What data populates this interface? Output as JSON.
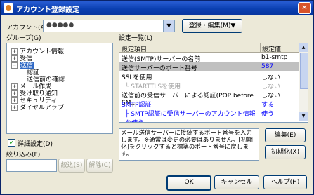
{
  "window": {
    "title": "アカウント登録設定",
    "close_label": "✕"
  },
  "account": {
    "label": "アカウント(A)",
    "value": "●●●●●"
  },
  "register_button": "登録・編集(M)▼",
  "group": {
    "label": "グループ(G)",
    "items": [
      {
        "label": "アカウント情報",
        "exp": "+"
      },
      {
        "label": "受信",
        "exp": "+"
      },
      {
        "label": "送信",
        "exp": "−"
      },
      {
        "label": "認証",
        "exp": ""
      },
      {
        "label": "送信前の確認",
        "exp": ""
      },
      {
        "label": "メール作成",
        "exp": "+"
      },
      {
        "label": "受け取り通知",
        "exp": "+"
      },
      {
        "label": "セキュリティ",
        "exp": "+"
      },
      {
        "label": "ダイヤルアップ",
        "exp": "+"
      }
    ]
  },
  "detail_checkbox": {
    "label": "詳細設定(D)",
    "checked": true
  },
  "filter": {
    "label": "絞り込み(F)",
    "value": "",
    "narrow_button": "絞込(S)",
    "clear_button": "解除(C)"
  },
  "settings": {
    "label": "設定一覧(L)",
    "col_item": "設定項目",
    "col_value": "設定値",
    "rows": [
      {
        "item": "送信(SMTP)サーバーの名前",
        "value": "b1-smtp",
        "item_color": "#000000",
        "value_color": "#000000"
      },
      {
        "item": "送信サーバーのポート番号",
        "value": "587",
        "item_color": "#000000",
        "value_color": "#0000ff"
      },
      {
        "item": "SSLを使用",
        "value": "しない",
        "item_color": "#000000",
        "value_color": "#000000"
      },
      {
        "item": "└ STARTTLSを使用",
        "value": "しない",
        "item_color": "#a0a0a0",
        "value_color": "#a0a0a0"
      },
      {
        "item": "送信前の受信サーバーによる認証(POP before SM...",
        "value": "しない",
        "item_color": "#000000",
        "value_color": "#000000"
      },
      {
        "item": "SMTP認証",
        "value": "する",
        "item_color": "#0000ff",
        "value_color": "#0000ff"
      },
      {
        "item": "├ SMTP認証に受信サーバーのアカウント情報を使う",
        "value": "使う",
        "item_color": "#0000ff",
        "value_color": "#0000ff"
      }
    ]
  },
  "description": "メール送信サーバーに接続するポート番号を入力します。※通常は変更の必要はありません。[初期化]をクリックすると標準のポート番号に戻します。",
  "edit_button": "編集(E)",
  "reset_button": "初期化(X)",
  "ok_button": "OK",
  "cancel_button": "キャンセル",
  "help_button": "ヘルプ(H)"
}
